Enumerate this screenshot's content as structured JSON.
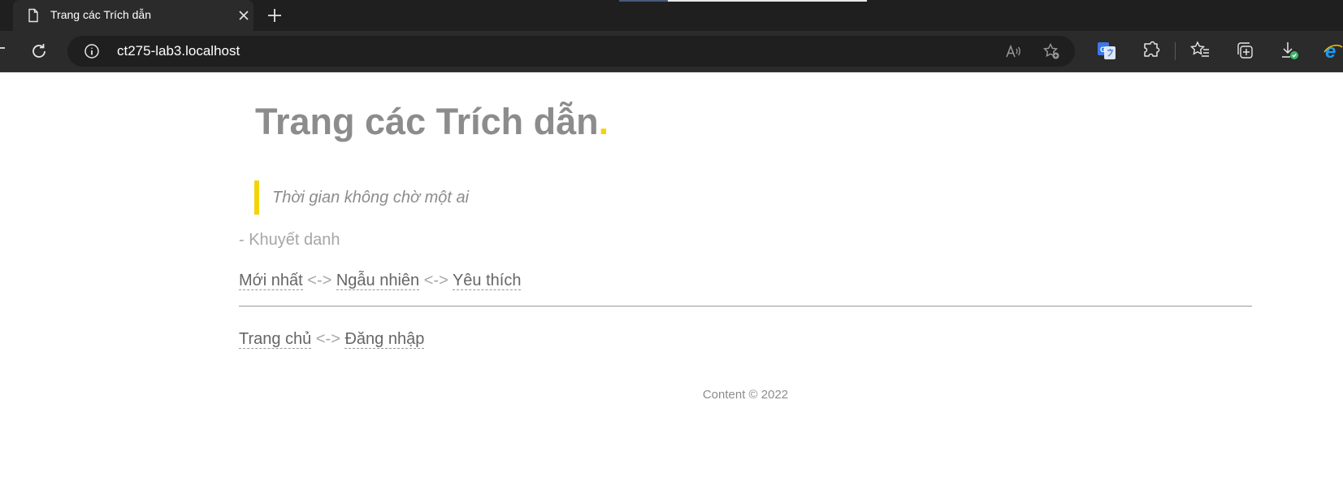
{
  "browser": {
    "tab": {
      "title": "Trang các Trích dẫn",
      "icon": "page-icon"
    },
    "address": {
      "url": "ct275-lab3.localhost"
    },
    "toolbar_icons": [
      "read-aloud-icon",
      "add-favorite-icon",
      "translate-icon",
      "extensions-icon",
      "favorites-icon",
      "collections-icon",
      "downloads-icon",
      "internet-explorer-icon"
    ]
  },
  "page": {
    "title": "Trang các Trích dẫn",
    "title_dot": ".",
    "quote": "Thời gian không chờ một ai",
    "author": "- Khuyết danh",
    "nav1": {
      "newest": "Mới nhất",
      "random": "Ngẫu nhiên",
      "favorite": "Yêu thích",
      "sep": "<->"
    },
    "nav2": {
      "home": "Trang chủ",
      "login": "Đăng nhập",
      "sep": "<->"
    },
    "footer": "Content © 2022"
  },
  "colors": {
    "accent": "#f5d30a",
    "text_gray": "#8c8c8c",
    "chrome_bg": "#2b2b2b"
  }
}
